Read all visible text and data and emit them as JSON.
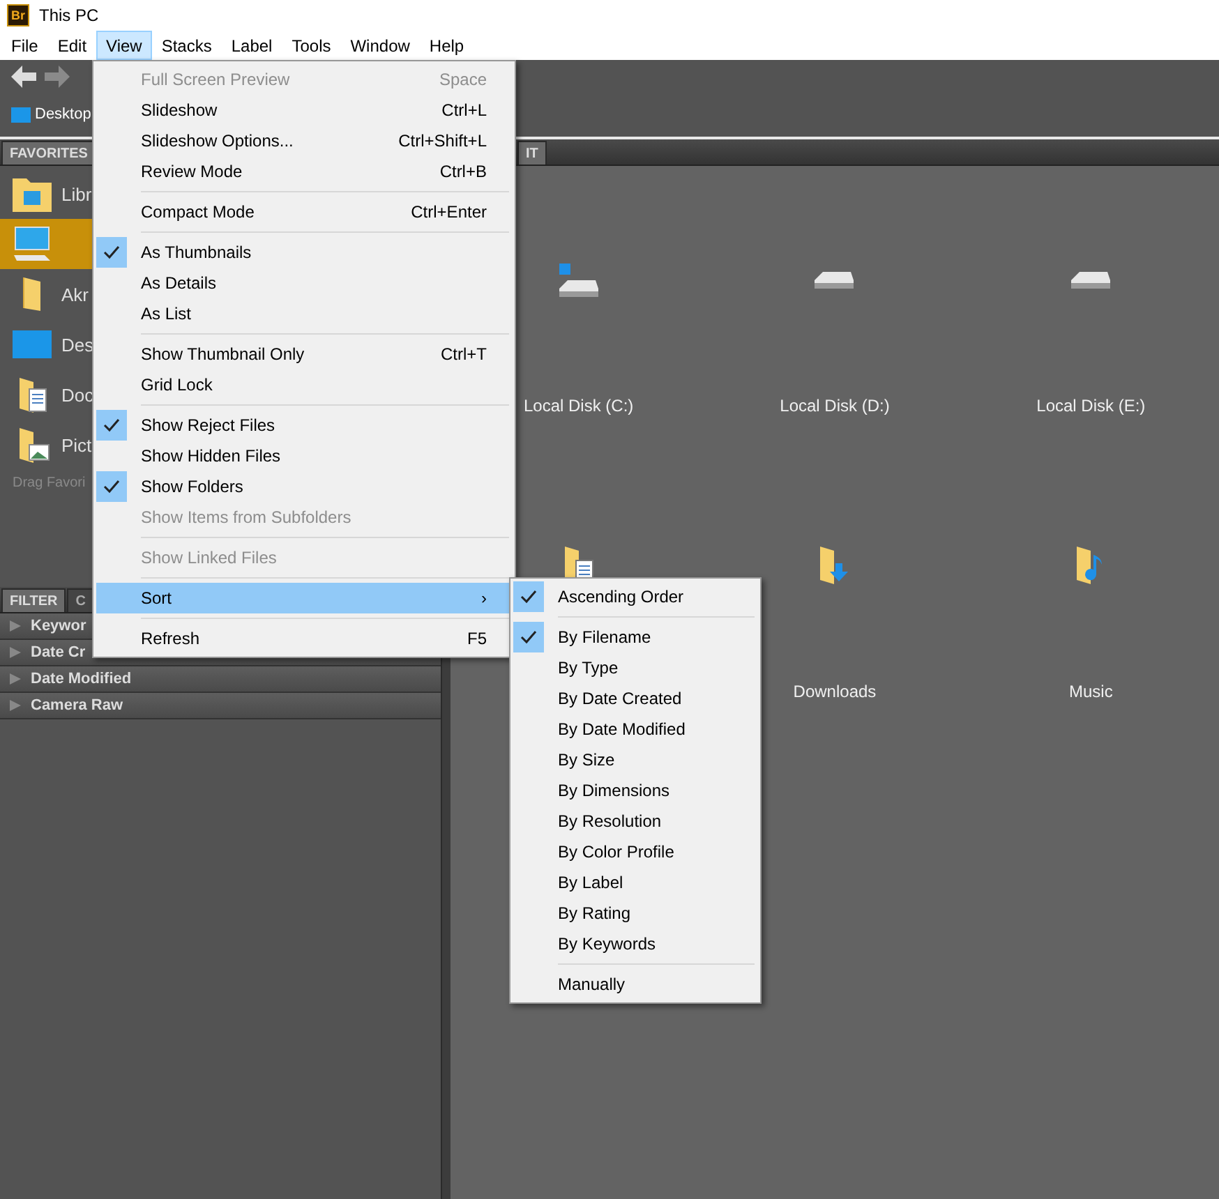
{
  "window": {
    "app_badge": "Br",
    "title": "This PC"
  },
  "menu_bar": [
    {
      "label": "File",
      "selected": false
    },
    {
      "label": "Edit",
      "selected": false
    },
    {
      "label": "View",
      "selected": true
    },
    {
      "label": "Stacks",
      "selected": false
    },
    {
      "label": "Label",
      "selected": false
    },
    {
      "label": "Tools",
      "selected": false
    },
    {
      "label": "Window",
      "selected": false
    },
    {
      "label": "Help",
      "selected": false
    }
  ],
  "path_bar": {
    "label": "Desktop"
  },
  "favorites_panel": {
    "tab": "FAVORITES",
    "items": [
      {
        "label": "Libr",
        "kind": "libraries",
        "selected": false
      },
      {
        "kind": "computer",
        "selected": true
      },
      {
        "label": "Akr",
        "kind": "folder",
        "selected": false
      },
      {
        "label": "Des",
        "kind": "desktop",
        "selected": false
      },
      {
        "label": "Doc",
        "kind": "documents",
        "selected": false
      },
      {
        "label": "Pict",
        "kind": "pictures",
        "selected": false
      }
    ],
    "hint": "Drag Favori"
  },
  "filter_panel": {
    "tabs": [
      {
        "label": "FILTER",
        "selected": true
      },
      {
        "label": "C",
        "selected": false
      }
    ],
    "rows": [
      {
        "label": "Keywor"
      },
      {
        "label": "Date Cr"
      },
      {
        "label": "Date Modified"
      },
      {
        "label": "Camera Raw"
      }
    ]
  },
  "content": {
    "tab": "IT",
    "items": [
      {
        "label": "Local Disk (C:)",
        "kind": "system-drive"
      },
      {
        "label": "Local Disk (D:)",
        "kind": "drive"
      },
      {
        "label": "Local Disk (E:)",
        "kind": "drive"
      },
      {
        "kind": "documents"
      },
      {
        "label": "Downloads",
        "kind": "downloads"
      },
      {
        "label": "Music",
        "kind": "music"
      }
    ]
  },
  "view_menu": [
    {
      "kind": "item",
      "label": "Full Screen Preview",
      "shortcut": "Space",
      "checked": false,
      "disabled": true,
      "selected": false
    },
    {
      "kind": "item",
      "label": "Slideshow",
      "shortcut": "Ctrl+L",
      "checked": false,
      "disabled": false,
      "selected": false
    },
    {
      "kind": "item",
      "label": "Slideshow Options...",
      "shortcut": "Ctrl+Shift+L",
      "checked": false,
      "disabled": false,
      "selected": false
    },
    {
      "kind": "item",
      "label": "Review Mode",
      "shortcut": "Ctrl+B",
      "checked": false,
      "disabled": false,
      "selected": false
    },
    {
      "kind": "separator"
    },
    {
      "kind": "item",
      "label": "Compact Mode",
      "shortcut": "Ctrl+Enter",
      "checked": false,
      "disabled": false,
      "selected": false
    },
    {
      "kind": "separator"
    },
    {
      "kind": "item",
      "label": "As Thumbnails",
      "checked": true,
      "disabled": false,
      "selected": false
    },
    {
      "kind": "item",
      "label": "As Details",
      "checked": false,
      "disabled": false,
      "selected": false
    },
    {
      "kind": "item",
      "label": "As List",
      "checked": false,
      "disabled": false,
      "selected": false
    },
    {
      "kind": "separator"
    },
    {
      "kind": "item",
      "label": "Show Thumbnail Only",
      "shortcut": "Ctrl+T",
      "checked": false,
      "disabled": false,
      "selected": false
    },
    {
      "kind": "item",
      "label": "Grid Lock",
      "checked": false,
      "disabled": false,
      "selected": false
    },
    {
      "kind": "separator"
    },
    {
      "kind": "item",
      "label": "Show Reject Files",
      "checked": true,
      "disabled": false,
      "selected": false
    },
    {
      "kind": "item",
      "label": "Show Hidden Files",
      "checked": false,
      "disabled": false,
      "selected": false
    },
    {
      "kind": "item",
      "label": "Show Folders",
      "checked": true,
      "disabled": false,
      "selected": false
    },
    {
      "kind": "item",
      "label": "Show Items from Subfolders",
      "checked": false,
      "disabled": true,
      "selected": false
    },
    {
      "kind": "separator"
    },
    {
      "kind": "item",
      "label": "Show Linked Files",
      "checked": false,
      "disabled": true,
      "selected": false
    },
    {
      "kind": "separator"
    },
    {
      "kind": "item",
      "label": "Sort",
      "submenu_arrow": "›",
      "checked": false,
      "disabled": false,
      "selected": true
    },
    {
      "kind": "separator"
    },
    {
      "kind": "item",
      "label": "Refresh",
      "shortcut": "F5",
      "checked": false,
      "disabled": false,
      "selected": false
    }
  ],
  "sort_menu": [
    {
      "kind": "item",
      "label": "Ascending Order",
      "checked": true
    },
    {
      "kind": "separator"
    },
    {
      "kind": "item",
      "label": "By Filename",
      "checked": true
    },
    {
      "kind": "item",
      "label": "By Type",
      "checked": false
    },
    {
      "kind": "item",
      "label": "By Date Created",
      "checked": false
    },
    {
      "kind": "item",
      "label": "By Date Modified",
      "checked": false
    },
    {
      "kind": "item",
      "label": "By Size",
      "checked": false
    },
    {
      "kind": "item",
      "label": "By Dimensions",
      "checked": false
    },
    {
      "kind": "item",
      "label": "By Resolution",
      "checked": false
    },
    {
      "kind": "item",
      "label": "By Color Profile",
      "checked": false
    },
    {
      "kind": "item",
      "label": "By Label",
      "checked": false
    },
    {
      "kind": "item",
      "label": "By Rating",
      "checked": false
    },
    {
      "kind": "item",
      "label": "By Keywords",
      "checked": false
    },
    {
      "kind": "separator"
    },
    {
      "kind": "item",
      "label": "Manually",
      "checked": false
    }
  ]
}
